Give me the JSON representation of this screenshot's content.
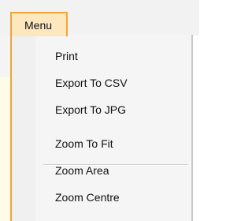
{
  "menu": {
    "title": "Menu",
    "items": [
      {
        "label": "Print"
      },
      {
        "label": "Export To CSV"
      },
      {
        "label": "Export To JPG"
      },
      {
        "label": "Zoom To Fit"
      },
      {
        "label": "Zoom Area"
      },
      {
        "label": "Zoom Centre"
      }
    ]
  },
  "colors": {
    "menu_highlight_border": "#f2a533",
    "menu_highlight_fill": "#fde7be",
    "dropdown_background": "#f5f5f5"
  }
}
